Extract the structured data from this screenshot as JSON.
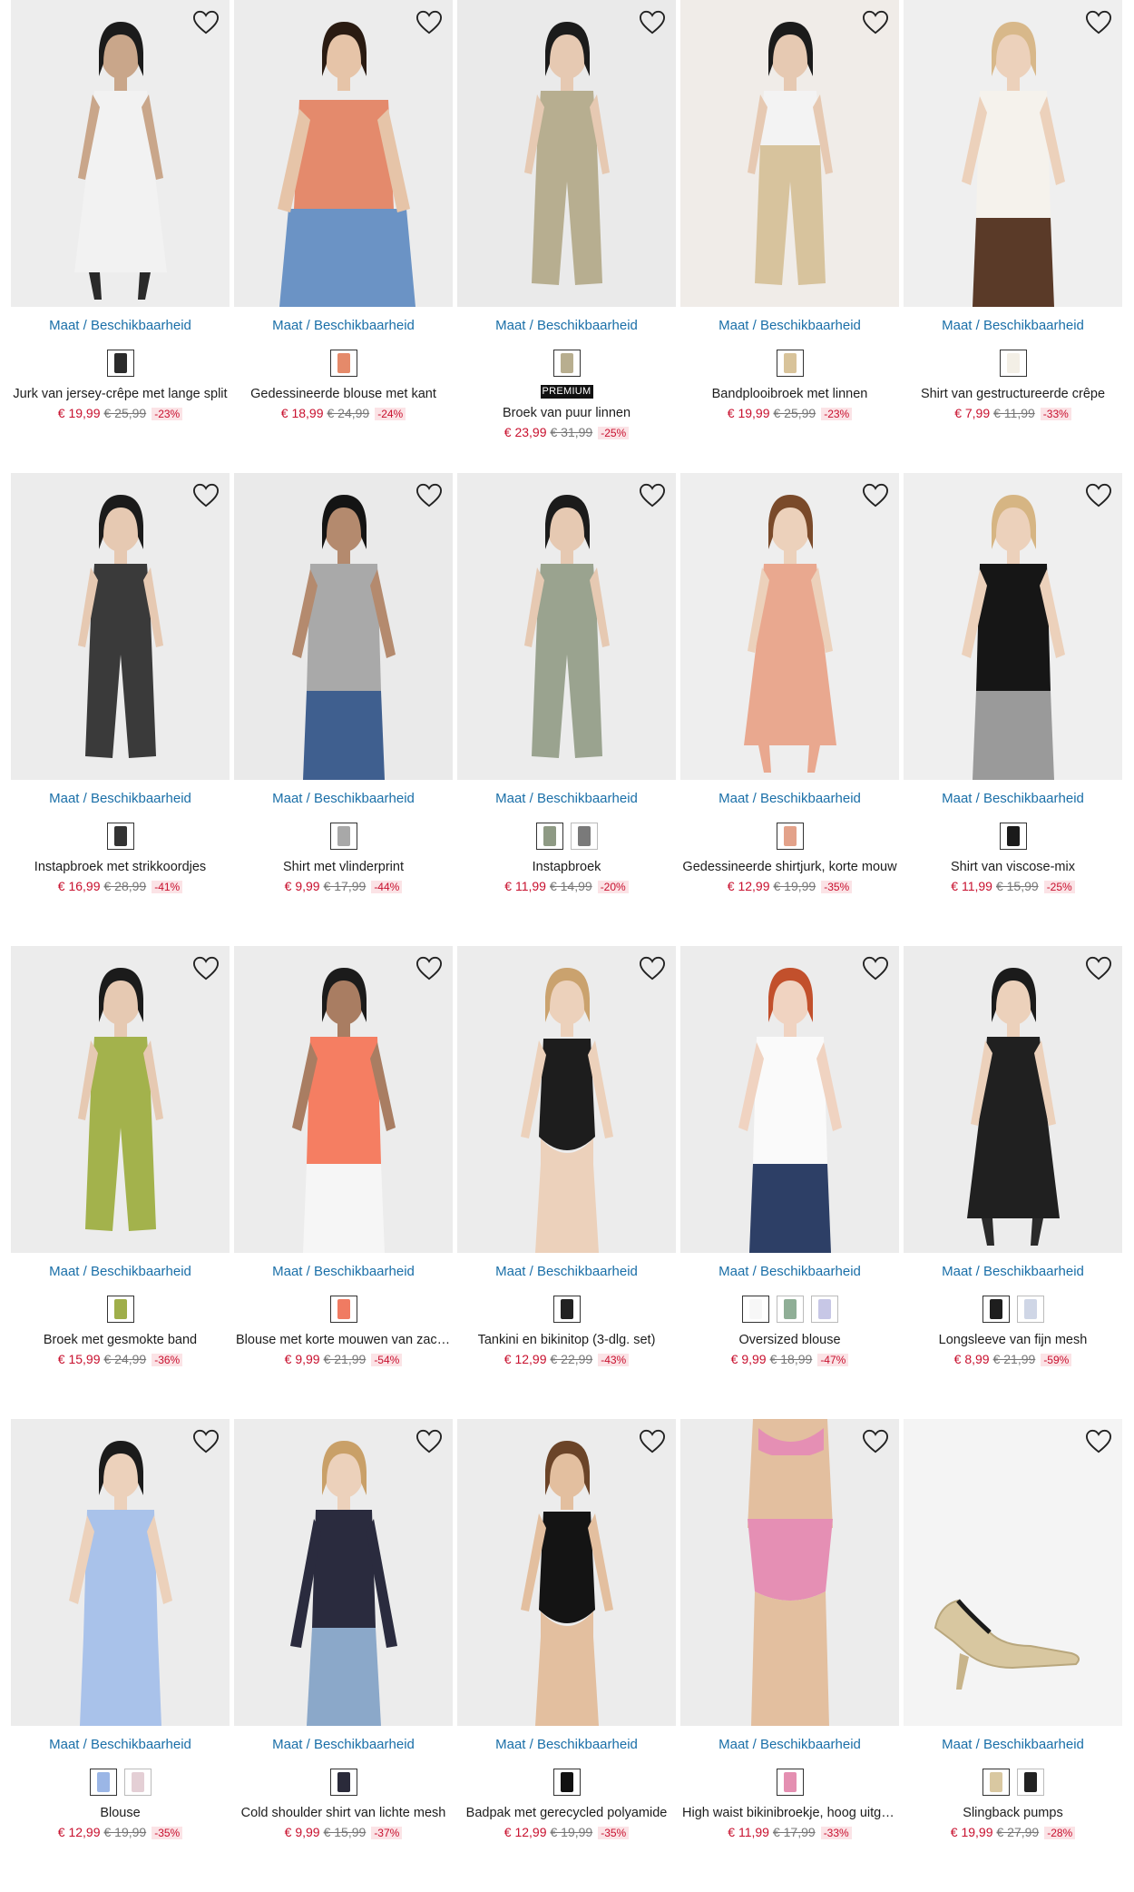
{
  "size_link_label": "Maat / Beschikbaarheid",
  "premium_label": "PREMIUM",
  "colors": {
    "price": "#c8102e",
    "link": "#1a6fa8"
  },
  "products": [
    {
      "name": "Jurk van jersey-crêpe met lange split",
      "price": "€ 19,99",
      "old_price": "€ 25,99",
      "discount": "-23%",
      "swatches": [
        "#2b2b2b"
      ],
      "bg": "#ededed",
      "top": "#f2f2f2",
      "bottom": "#2a2a2a",
      "skin": "#c9a68a",
      "hair": "#1b1b1b",
      "kind": "dress"
    },
    {
      "name": "Gedessineerde blouse met kant",
      "price": "€ 18,99",
      "old_price": "€ 24,99",
      "discount": "-24%",
      "swatches": [
        "#e58a6a"
      ],
      "bg": "#ececec",
      "top": "#e48a6c",
      "bottom": "#6b93c5",
      "skin": "#e6c4a8",
      "hair": "#2a1b12",
      "kind": "seated"
    },
    {
      "name": "Broek van puur linnen",
      "price": "€ 23,99",
      "old_price": "€ 31,99",
      "discount": "-25%",
      "swatches": [
        "#b8ae8f"
      ],
      "premium": true,
      "bg": "#eaeaea",
      "top": "#b7ae90",
      "bottom": "#b7ae90",
      "skin": "#e6c9b2",
      "hair": "#1b1b1b",
      "kind": "pants"
    },
    {
      "name": "Bandplooibroek met linnen",
      "price": "€ 19,99",
      "old_price": "€ 25,99",
      "discount": "-23%",
      "swatches": [
        "#d8c39a"
      ],
      "bg": "#f0ece8",
      "top": "#f3f3f3",
      "bottom": "#d7c39d",
      "skin": "#e6c9b2",
      "hair": "#1b1b1b",
      "kind": "pants"
    },
    {
      "name": "Shirt van gestructureerde crêpe",
      "price": "€ 7,99",
      "old_price": "€ 11,99",
      "discount": "-33%",
      "swatches": [
        "#f3efe6"
      ],
      "bg": "#efefef",
      "top": "#f5f2ec",
      "bottom": "#5a3a28",
      "skin": "#ecd1bb",
      "hair": "#d8b88a",
      "kind": "top"
    },
    {
      "name": "Instapbroek met strikkoordjes",
      "price": "€ 16,99",
      "old_price": "€ 28,99",
      "discount": "-41%",
      "swatches": [
        "#333333"
      ],
      "bg": "#ececec",
      "top": "#3a3a3a",
      "bottom": "#3a3a3a",
      "skin": "#e6c9b2",
      "hair": "#1b1b1b",
      "kind": "pants"
    },
    {
      "name": "Shirt met vlinderprint",
      "price": "€ 9,99",
      "old_price": "€ 17,99",
      "discount": "-44%",
      "swatches": [
        "#a8a8a8"
      ],
      "bg": "#eaeaea",
      "top": "#a9a9a9",
      "bottom": "#3f5f8f",
      "skin": "#b48a6e",
      "hair": "#141414",
      "kind": "top"
    },
    {
      "name": "Instapbroek",
      "price": "€ 11,99",
      "old_price": "€ 14,99",
      "discount": "-20%",
      "swatches": [
        "#8e9a84",
        "#7a7a7a"
      ],
      "bg": "#ececec",
      "top": "#9aa38f",
      "bottom": "#9aa38f",
      "skin": "#e6c9b2",
      "hair": "#1b1b1b",
      "kind": "pants"
    },
    {
      "name": "Gedessineerde shirtjurk, korte mouw",
      "price": "€ 12,99",
      "old_price": "€ 19,99",
      "discount": "-35%",
      "swatches": [
        "#e3a28a"
      ],
      "bg": "#eeeeee",
      "top": "#e9a88f",
      "bottom": "#e9a88f",
      "skin": "#ecd1bb",
      "hair": "#7a4a2a",
      "kind": "dress"
    },
    {
      "name": "Shirt van viscose-mix",
      "price": "€ 11,99",
      "old_price": "€ 15,99",
      "discount": "-25%",
      "swatches": [
        "#1a1a1a"
      ],
      "bg": "#efefef",
      "top": "#161616",
      "bottom": "#9a9a9a",
      "skin": "#ecd1bb",
      "hair": "#d6b583",
      "kind": "top"
    },
    {
      "name": "Broek met gesmokte band",
      "price": "€ 15,99",
      "old_price": "€ 24,99",
      "discount": "-36%",
      "swatches": [
        "#9fae4a"
      ],
      "bg": "#ececec",
      "top": "#a3b24c",
      "bottom": "#a3b24c",
      "skin": "#e6c9b2",
      "hair": "#1b1b1b",
      "kind": "pants"
    },
    {
      "name": "Blouse met korte mouwen van zachte viscose",
      "price": "€ 9,99",
      "old_price": "€ 21,99",
      "discount": "-54%",
      "swatches": [
        "#f07b62"
      ],
      "bg": "#ececec",
      "top": "#f57e62",
      "bottom": "#f6f6f6",
      "skin": "#a97d62",
      "hair": "#1b1b1b",
      "kind": "top"
    },
    {
      "name": "Tankini en bikinitop (3-dlg. set)",
      "price": "€ 12,99",
      "old_price": "€ 22,99",
      "discount": "-43%",
      "swatches": [
        "#222222"
      ],
      "bg": "#ececec",
      "top": "#1d1d1d",
      "bottom": "#1d1d1d",
      "skin": "#ecd1bb",
      "hair": "#caa26e",
      "kind": "swim"
    },
    {
      "name": "Oversized blouse",
      "price": "€ 9,99",
      "old_price": "€ 18,99",
      "discount": "-47%",
      "swatches": [
        "#f7f7f7",
        "#8fae96",
        "#c7c7e6"
      ],
      "bg": "#ececec",
      "top": "#fafafa",
      "bottom": "#2d3f66",
      "skin": "#f0d3c1",
      "hair": "#c2502c",
      "kind": "top"
    },
    {
      "name": "Longsleeve van fijn mesh",
      "price": "€ 8,99",
      "old_price": "€ 21,99",
      "discount": "-59%",
      "swatches": [
        "#1e1e1e",
        "#cfd6e6"
      ],
      "bg": "#ececec",
      "top": "#202020",
      "bottom": "#2a2a2a",
      "skin": "#ecd1bb",
      "hair": "#1b1b1b",
      "kind": "dress"
    },
    {
      "name": "Blouse",
      "price": "€ 12,99",
      "old_price": "€ 19,99",
      "discount": "-35%",
      "swatches": [
        "#9bb6e6",
        "#e4cfd5"
      ],
      "bg": "#ececec",
      "top": "#a9c2ea",
      "bottom": "#a9c2ea",
      "skin": "#ecd1bb",
      "hair": "#1b1b1b",
      "kind": "top"
    },
    {
      "name": "Cold shoulder shirt van lichte mesh",
      "price": "€ 9,99",
      "old_price": "€ 15,99",
      "discount": "-37%",
      "swatches": [
        "#2a2a3a"
      ],
      "bg": "#ececec",
      "top": "#2a2b3e",
      "bottom": "#8ba8c9",
      "skin": "#ecd1bb",
      "hair": "#c9a068",
      "kind": "back"
    },
    {
      "name": "Badpak met gerecycled polyamide",
      "price": "€ 12,99",
      "old_price": "€ 19,99",
      "discount": "-35%",
      "swatches": [
        "#111111"
      ],
      "bg": "#ececec",
      "top": "#141414",
      "bottom": "#141414",
      "skin": "#e3bf9f",
      "hair": "#6b4428",
      "kind": "swim"
    },
    {
      "name": "High waist bikinibroekje, hoog uitgesneden",
      "price": "€ 11,99",
      "old_price": "€ 17,99",
      "discount": "-33%",
      "swatches": [
        "#e48fb1"
      ],
      "bg": "#ececec",
      "top": "#e58fb4",
      "bottom": "#e58fb4",
      "skin": "#e3bf9f",
      "hair": "#6b4428",
      "kind": "bikini"
    },
    {
      "name": "Slingback pumps",
      "price": "€ 19,99",
      "old_price": "€ 27,99",
      "discount": "-28%",
      "swatches": [
        "#d9c8a1",
        "#222222"
      ],
      "bg": "#f4f4f4",
      "top": "#d8c7a0",
      "bottom": "#d8c7a0",
      "skin": "#ecd1bb",
      "hair": "#1b1b1b",
      "kind": "shoe"
    }
  ]
}
